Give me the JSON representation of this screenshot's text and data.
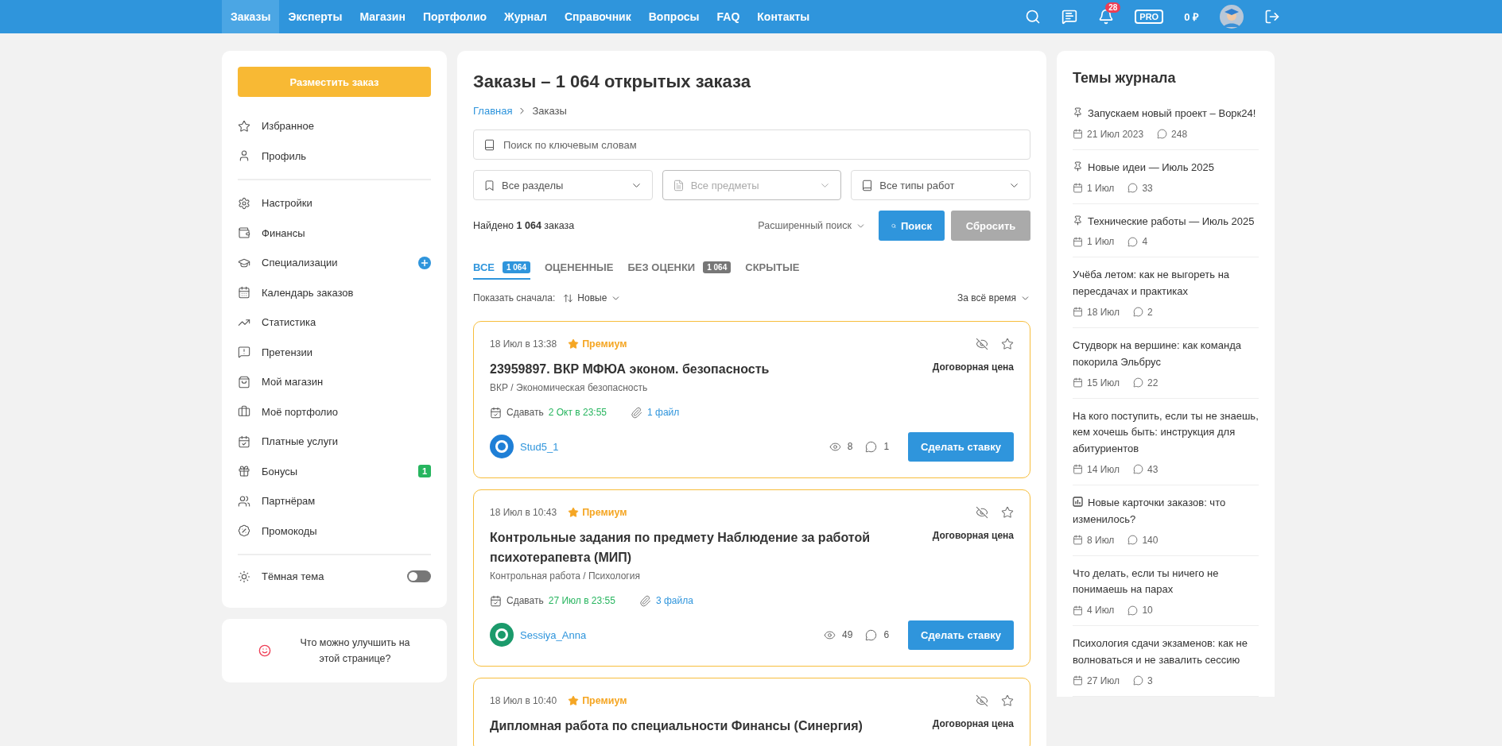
{
  "nav": {
    "items": [
      {
        "label": "Заказы",
        "selected": true
      },
      {
        "label": "Эксперты",
        "selected": false
      },
      {
        "label": "Магазин",
        "selected": false
      },
      {
        "label": "Портфолио",
        "selected": false
      },
      {
        "label": "Журнал",
        "selected": false
      },
      {
        "label": "Справочник",
        "selected": false
      },
      {
        "label": "Вопросы",
        "selected": false
      },
      {
        "label": "FAQ",
        "selected": false
      },
      {
        "label": "Контакты",
        "selected": false
      }
    ],
    "notifications": "28",
    "pro": "PRO",
    "balance": "0 ₽"
  },
  "sidebar": {
    "cta": "Разместить заказ",
    "groups": [
      [
        {
          "label": "Избранное",
          "kind": "plain"
        },
        {
          "label": "Профиль",
          "kind": "plain"
        }
      ],
      [
        {
          "label": "Настройки",
          "kind": "plain"
        },
        {
          "label": "Финансы",
          "kind": "plain"
        },
        {
          "label": "Специализации",
          "kind": "add"
        },
        {
          "label": "Календарь заказов",
          "kind": "plain"
        },
        {
          "label": "Статистика",
          "kind": "plain"
        },
        {
          "label": "Претензии",
          "kind": "plain"
        },
        {
          "label": "Мой магазин",
          "kind": "plain"
        },
        {
          "label": "Моё портфолио",
          "kind": "plain"
        },
        {
          "label": "Платные услуги",
          "kind": "plain"
        },
        {
          "label": "Бонусы",
          "kind": "count",
          "count": "1"
        },
        {
          "label": "Партнёрам",
          "kind": "plain"
        },
        {
          "label": "Промокоды",
          "kind": "plain"
        }
      ]
    ],
    "dark_theme": {
      "label": "Тёмная тема",
      "on": false
    },
    "feedback": "Что можно улучшить на этой странице?"
  },
  "main": {
    "title": "Заказы – 1 064 открытых заказа",
    "breadcrumbs": [
      "Главная",
      "Заказы"
    ],
    "search": {
      "placeholder": "Поиск по ключевым словам"
    },
    "filters": [
      {
        "label": "Все разделы",
        "disabled": false
      },
      {
        "label": "Все предметы",
        "disabled": true
      },
      {
        "label": "Все типы работ",
        "disabled": false
      }
    ],
    "found": "Найдено **1 064** заказа",
    "advanced": "Расширенный поиск",
    "search_button": "Поиск",
    "reset_button": "Сбросить",
    "tabs": [
      {
        "label": "ВСЕ",
        "count": "1 064",
        "selected": true
      },
      {
        "label": "ОЦЕНЕННЫЕ",
        "selected": false
      },
      {
        "label": "БЕЗ ОЦЕНКИ",
        "count": "1 064",
        "selected": false
      },
      {
        "label": "СКРЫТЫЕ",
        "selected": false
      }
    ],
    "sort_label": "Показать сначала:",
    "sort_value": "Новые",
    "period": "За всё время",
    "orders": [
      {
        "date": "18 Июл в 13:38",
        "premium": true,
        "premium_label": "Премиум",
        "title": "23959897. ВКР МФЮА эконом. безопасность",
        "price": "Договорная цена",
        "category": "ВКР / Экономическая безопасность",
        "deadline_label": "Сдавать",
        "deadline": "2 Окт в 23:55",
        "files": "1 файл",
        "author": "Stud5_1",
        "color": "#1f7fd6",
        "views": "8",
        "comments": "1",
        "bid": "Сделать ставку"
      },
      {
        "date": "18 Июл в 10:43",
        "premium": true,
        "premium_label": "Премиум",
        "title": "Контрольные задания по предмету Наблюдение за работой психотерапевта (МИП)",
        "price": "Договорная цена",
        "category": "Контрольная работа / Психология",
        "deadline_label": "Сдавать",
        "deadline": "27 Июл в 23:55",
        "files": "3 файла",
        "author": "Sessiya_Anna",
        "color": "#1b9a6b",
        "views": "49",
        "comments": "6",
        "bid": "Сделать ставку"
      },
      {
        "date": "18 Июл в 10:40",
        "premium": true,
        "premium_label": "Премиум",
        "title": "Дипломная работа по специальности Финансы (Синергия)",
        "price": "Договорная цена"
      }
    ]
  },
  "journal": {
    "title": "Темы журнала",
    "items": [
      {
        "title": "Запускаем новый проект – Ворк24!",
        "kind": "pinned",
        "date": "21 Июл 2023",
        "comments": "248"
      },
      {
        "title": "Новые идеи — Июль 2025",
        "kind": "pinned",
        "date": "1 Июл",
        "comments": "33"
      },
      {
        "title": "Технические работы — Июль 2025",
        "kind": "pinned",
        "date": "1 Июл",
        "comments": "4"
      },
      {
        "title": "Учёба летом: как не выгореть на пересдачах и практиках",
        "kind": "plain",
        "date": "18 Июл",
        "comments": "2"
      },
      {
        "title": "Студворк на вершине: как команда покорила Эльбрус",
        "kind": "plain",
        "date": "15 Июл",
        "comments": "22"
      },
      {
        "title": "На кого поступить, если ты не знаешь, кем хочешь быть: инструкция для абитуриентов",
        "kind": "plain",
        "date": "14 Июл",
        "comments": "43"
      },
      {
        "title": "Новые карточки заказов: что изменилось?",
        "kind": "chart",
        "date": "8 Июл",
        "comments": "140"
      },
      {
        "title": "Что делать, если ты ничего не понимаешь на парах",
        "kind": "plain",
        "date": "4 Июл",
        "comments": "10"
      },
      {
        "title": "Психология сдачи экзаменов: как не волноваться и не завалить сессию",
        "kind": "plain",
        "date": "27 Июл",
        "comments": "3"
      }
    ]
  }
}
